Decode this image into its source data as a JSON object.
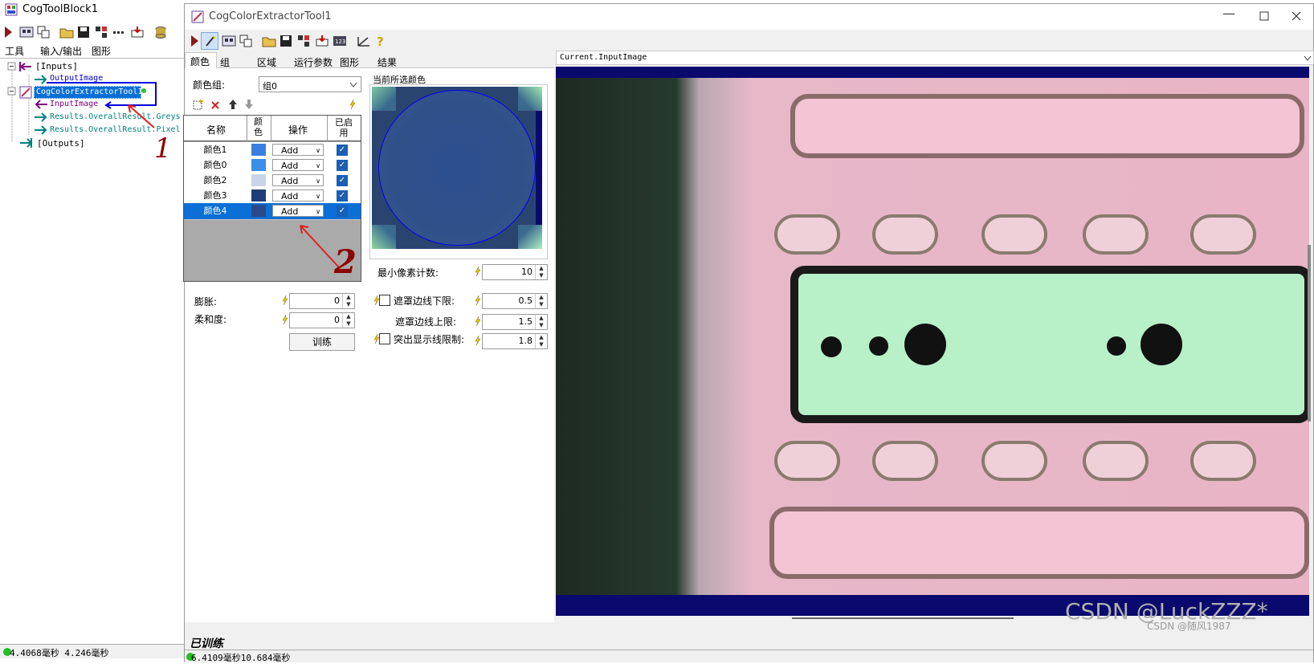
{
  "left_window": {
    "title": "CogToolBlock1",
    "tabs": [
      "工具",
      "输入/输出",
      "图形"
    ],
    "tree": {
      "inputs": "[Inputs]",
      "output_image": "OutputImage",
      "tool": "CogColorExtractorTool1",
      "input_image": "InputImage",
      "result1": "Results.OverallResult.Greys",
      "result2": "Results.OverallResult.Pixel",
      "outputs": "[Outputs]"
    },
    "status": "4.4068毫秒 4.246毫秒",
    "annotation": "1"
  },
  "main_window": {
    "title": "CogColorExtractorTool1",
    "tabs": [
      "颜色",
      "组",
      "区域",
      "运行参数",
      "图形",
      "结果"
    ],
    "color_group_label": "颜色组:",
    "color_group_value": "组0",
    "selected_color_label": "当前所选颜色",
    "table": {
      "headers": {
        "name": "名称",
        "color": "颜色",
        "op": "操作",
        "enabled": "已启用"
      },
      "rows": [
        {
          "name": "颜色1",
          "swatch": "#3b7fe0",
          "op": "Add",
          "enabled": true,
          "selected": false
        },
        {
          "name": "颜色0",
          "swatch": "#3c8ee8",
          "op": "Add",
          "enabled": true,
          "selected": false
        },
        {
          "name": "颜色2",
          "swatch": "#c8d4e8",
          "op": "Add",
          "enabled": true,
          "selected": false
        },
        {
          "name": "颜色3",
          "swatch": "#1f3d78",
          "op": "Add",
          "enabled": true,
          "selected": false
        },
        {
          "name": "颜色4",
          "swatch": "#2a4a8a",
          "op": "Add",
          "enabled": true,
          "selected": true
        }
      ]
    },
    "dilate_label": "膨胀:",
    "dilate_value": "0",
    "softness_label": "柔和度:",
    "softness_value": "0",
    "train_button": "训练",
    "min_pixel_label": "最小像素计数:",
    "min_pixel_value": "10",
    "mask_lower_label": "遮罩边线下限:",
    "mask_lower_value": "0.5",
    "mask_upper_label": "遮罩边线上限:",
    "mask_upper_value": "1.5",
    "highlight_label": "突出显示线限制:",
    "highlight_value": "1.8",
    "trained_status": "已训练",
    "image_selector": "Current.InputImage",
    "status": "6.4109毫秒10.684毫秒",
    "annotation": "2"
  },
  "watermark": "CSDN @LuckZZZ*",
  "watermark_small": "CSDN @随风1987",
  "colors": {
    "accent": "#0a6fd6",
    "tree_blue": "#0000cc",
    "annotation_red": "#8b0000",
    "image_border": "#0a0a6e"
  }
}
